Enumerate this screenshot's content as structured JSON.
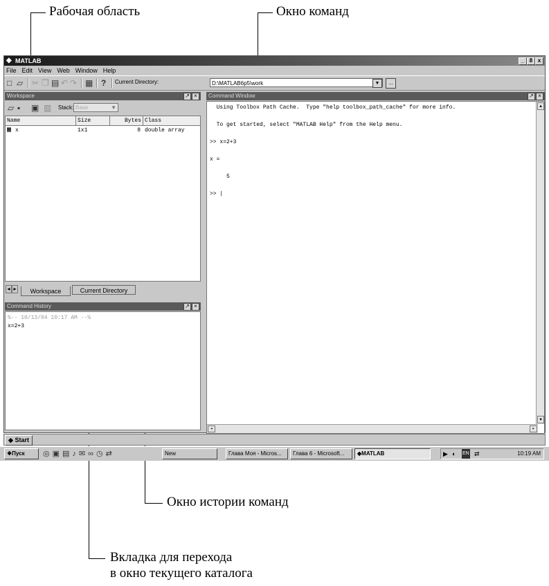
{
  "annotations": {
    "workspace_area": "Рабочая область",
    "command_window": "Окно команд",
    "command_history": "Окно истории команд",
    "tab_note_line1": "Вкладка для перехода",
    "tab_note_line2": "в окно текущего каталога"
  },
  "window": {
    "title": "MATLAB",
    "controls": [
      "_",
      "8",
      "x"
    ]
  },
  "menu": [
    "File",
    "Edit",
    "View",
    "Web",
    "Window",
    "Help"
  ],
  "toolbar": {
    "current_directory_label": "Current Directory:",
    "current_directory_value": "D:\\MATLAB6p5\\work",
    "browse_label": "..."
  },
  "workspace": {
    "title": "Workspace",
    "stack_label": "Stack:",
    "stack_value": "Base",
    "columns": [
      "Name",
      "Size",
      "Bytes",
      "Class"
    ],
    "rows": [
      {
        "name": "x",
        "size": "1x1",
        "bytes": "8",
        "class": "double array"
      }
    ],
    "tabs": [
      "Workspace",
      "Current Directory"
    ]
  },
  "history": {
    "title": "Command History",
    "lines": [
      "%-- 10/13/04 10:17 AM --%",
      "x=2+3"
    ]
  },
  "command_window": {
    "title": "Command Window",
    "lines": [
      "  Using Toolbox Path Cache.  Type \"help toolbox_path_cache\" for more info.",
      "",
      "  To get started, select \"MATLAB Help\" from the Help menu.",
      "",
      ">> x=2+3",
      "",
      "x =",
      "",
      "     5",
      "",
      ">> |"
    ]
  },
  "status": {
    "start_label": "Start"
  },
  "taskbar": {
    "start_label": "Пуск",
    "tasks": [
      "New",
      "Глава Моя - Micros...",
      "Глава 6 - Microsoft...",
      "MATLAB"
    ],
    "tray_lang": "EN",
    "clock": "10:19 AM"
  }
}
